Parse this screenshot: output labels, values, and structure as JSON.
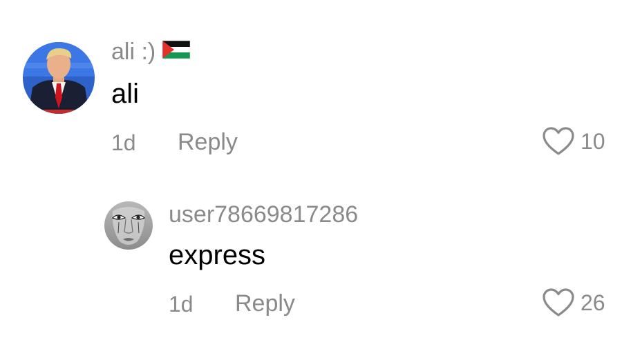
{
  "comments": [
    {
      "username": "ali :)",
      "flag_icon": "palestine-flag-icon",
      "text": "ali",
      "time": "1d",
      "reply_label": "Reply",
      "likes": "10"
    },
    {
      "username": "user78669817286",
      "text": "express",
      "time": "1d",
      "reply_label": "Reply",
      "likes": "26"
    }
  ],
  "colors": {
    "meta_text": "#8a8a8a",
    "body_text": "#000000",
    "flag_black": "#111111",
    "flag_green": "#149954",
    "flag_red": "#e4312b"
  }
}
